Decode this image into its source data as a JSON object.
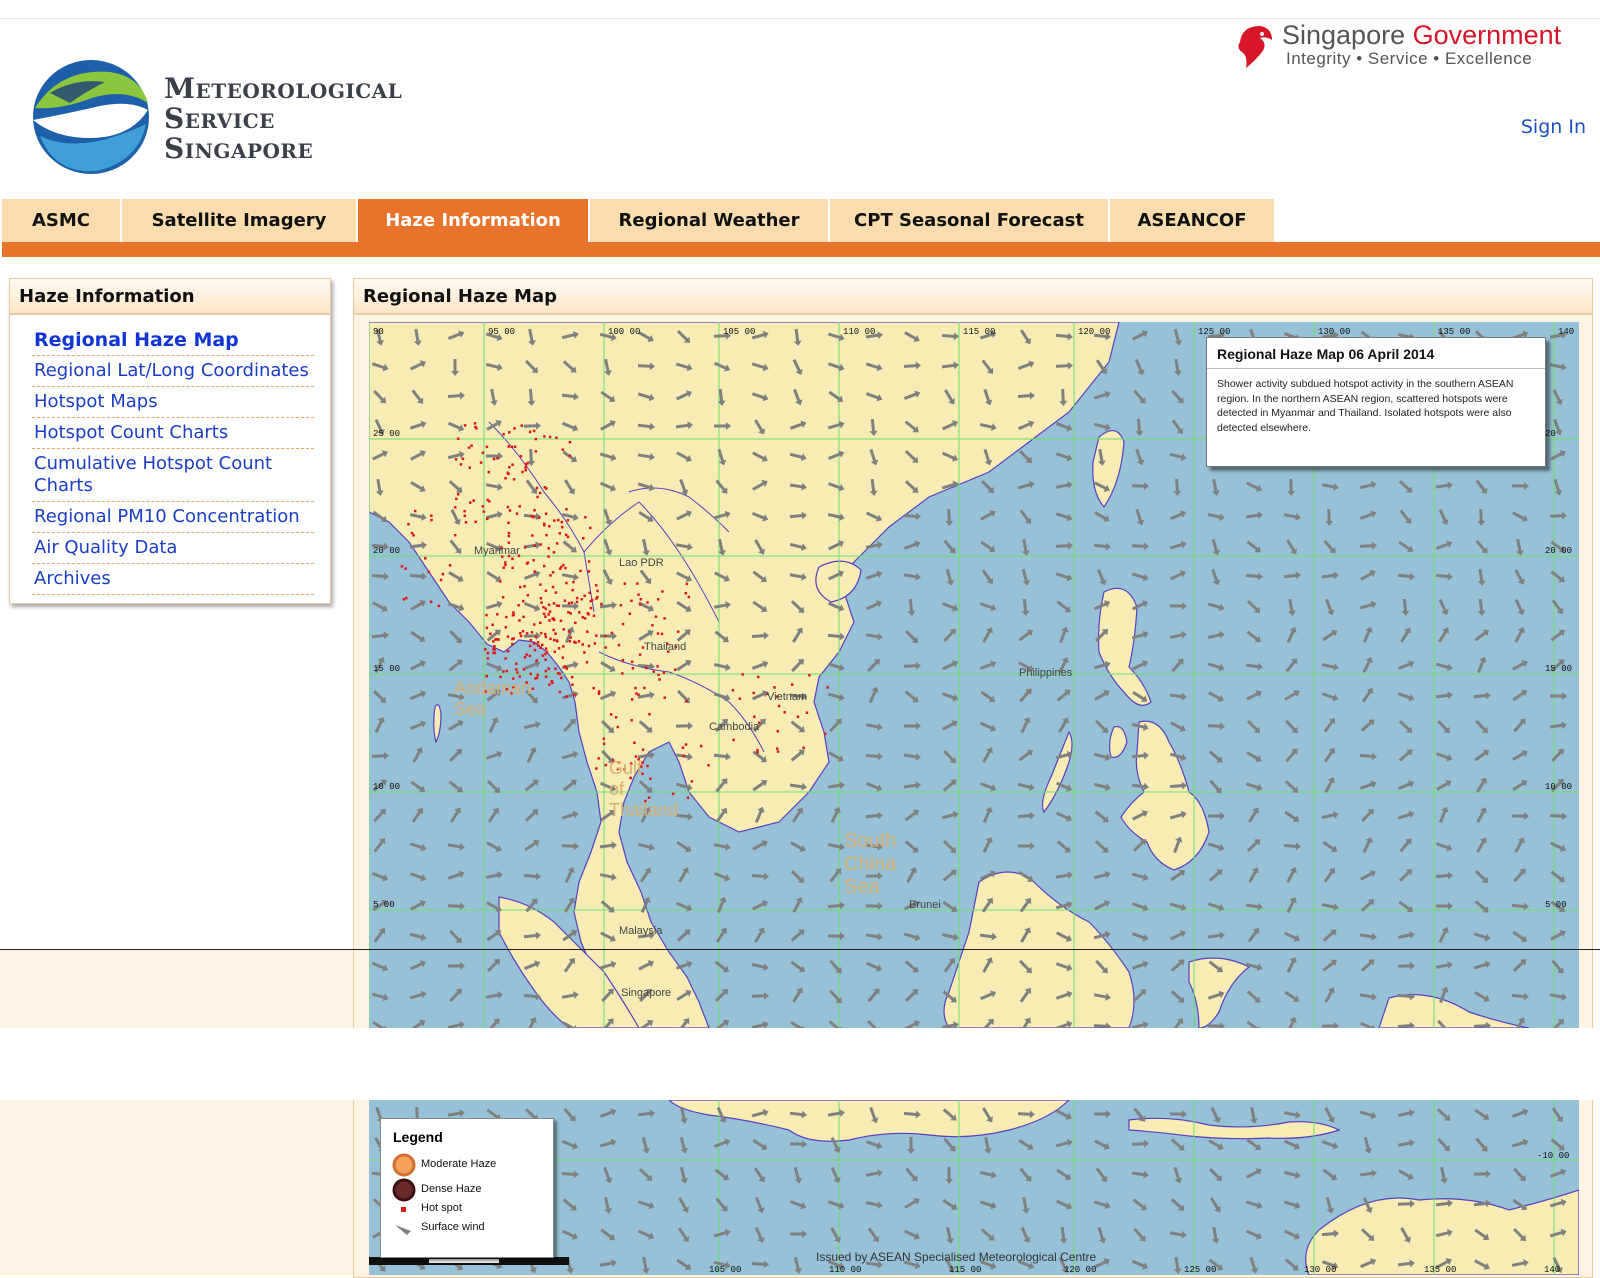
{
  "header": {
    "logo_text": [
      "Meteorological",
      "Service",
      "Singapore"
    ],
    "gov_text_gray": "Singapore ",
    "gov_text_red": "Government",
    "gov_tagline": "Integrity • Service • Excellence",
    "sign_in": "Sign In"
  },
  "nav": {
    "tabs": [
      {
        "label": "ASMC",
        "active": false
      },
      {
        "label": "Satellite Imagery",
        "active": false
      },
      {
        "label": "Haze Information",
        "active": true
      },
      {
        "label": "Regional Weather",
        "active": false
      },
      {
        "label": "CPT Seasonal Forecast",
        "active": false
      },
      {
        "label": "ASEANCOF",
        "active": false
      }
    ]
  },
  "sidebar": {
    "title": "Haze Information",
    "items": [
      {
        "label": "Regional Haze Map",
        "current": true
      },
      {
        "label": "Regional Lat/Long Coordinates"
      },
      {
        "label": "Hotspot Maps"
      },
      {
        "label": "Hotspot Count Charts"
      },
      {
        "label": "Cumulative Hotspot Count Charts"
      },
      {
        "label": "Regional PM10 Concentration"
      },
      {
        "label": "Air Quality Data"
      },
      {
        "label": "Archives"
      }
    ]
  },
  "main": {
    "title": "Regional Haze Map"
  },
  "map": {
    "info_title": "Regional Haze Map 06 April 2014",
    "info_body": "Shower activity subdued hotspot activity in the southern ASEAN region. In the northern ASEAN region, scattered hotspots were detected in Myanmar and Thailand. Isolated hotspots were also detected elsewhere.",
    "lon_labels": [
      "90",
      "95 00",
      "100 00",
      "105 00",
      "110 00",
      "115 00",
      "120 00",
      "125 00",
      "130 00",
      "135 00",
      "140"
    ],
    "lat_labels": [
      "25 00",
      "20 00",
      "15 00",
      "10 00",
      "5 00"
    ],
    "right_lat_labels": [
      "20",
      "20 00",
      "15 00",
      "10 00",
      "5 00"
    ],
    "place_labels": [
      "Myanmar",
      "Lao PDR",
      "Thailand",
      "Andaman Sea",
      "Vietnam",
      "Cambodia",
      "Gulf of Thailand",
      "Philippines",
      "South China Sea",
      "Brunei",
      "Malaysia",
      "Singapore"
    ],
    "bottom_lat_label": "-10 00",
    "bottom_lon_labels": [
      "105 00",
      "110 00",
      "115 00",
      "120 00",
      "125 00",
      "130 00",
      "135 00",
      "140"
    ],
    "legend": {
      "title": "Legend",
      "moderate": "Moderate Haze",
      "dense": "Dense Haze",
      "hotspot": "Hot spot",
      "wind": "Surface wind"
    },
    "issued": "Issued by ASEAN Specialised Meteorological Centre",
    "colors": {
      "sea": "#97c1d6",
      "land": "#f7ecb4",
      "grid": "#6be06b",
      "hotspot": "#e01818",
      "arrow": "#808080",
      "coast": "#5a3fc0"
    }
  }
}
